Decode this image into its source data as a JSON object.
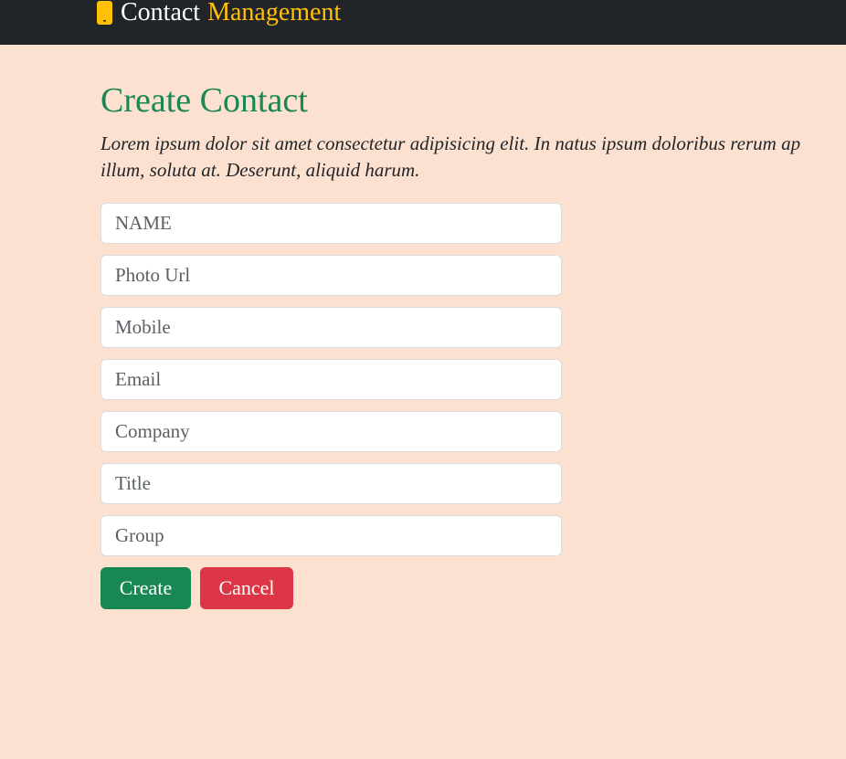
{
  "navbar": {
    "brand_part1": "Contact",
    "brand_part2": "Management",
    "icon": "phone-icon",
    "accent_color": "#ffc107"
  },
  "main": {
    "title": "Create Contact",
    "description_line1": "Lorem ipsum dolor sit amet consectetur adipisicing elit. In natus ipsum doloribus rerum ap",
    "description_line2": "illum, soluta at. Deserunt, aliquid harum.",
    "form": {
      "name_placeholder": "NAME",
      "photo_placeholder": "Photo Url",
      "mobile_placeholder": "Mobile",
      "email_placeholder": "Email",
      "company_placeholder": "Company",
      "title_placeholder": "Title",
      "group_placeholder": "Group"
    },
    "buttons": {
      "create": "Create",
      "cancel": "Cancel"
    }
  },
  "colors": {
    "background": "#fce1d0",
    "navbar": "#212529",
    "title": "#198754",
    "create_button": "#198754",
    "cancel_button": "#dc3545"
  }
}
